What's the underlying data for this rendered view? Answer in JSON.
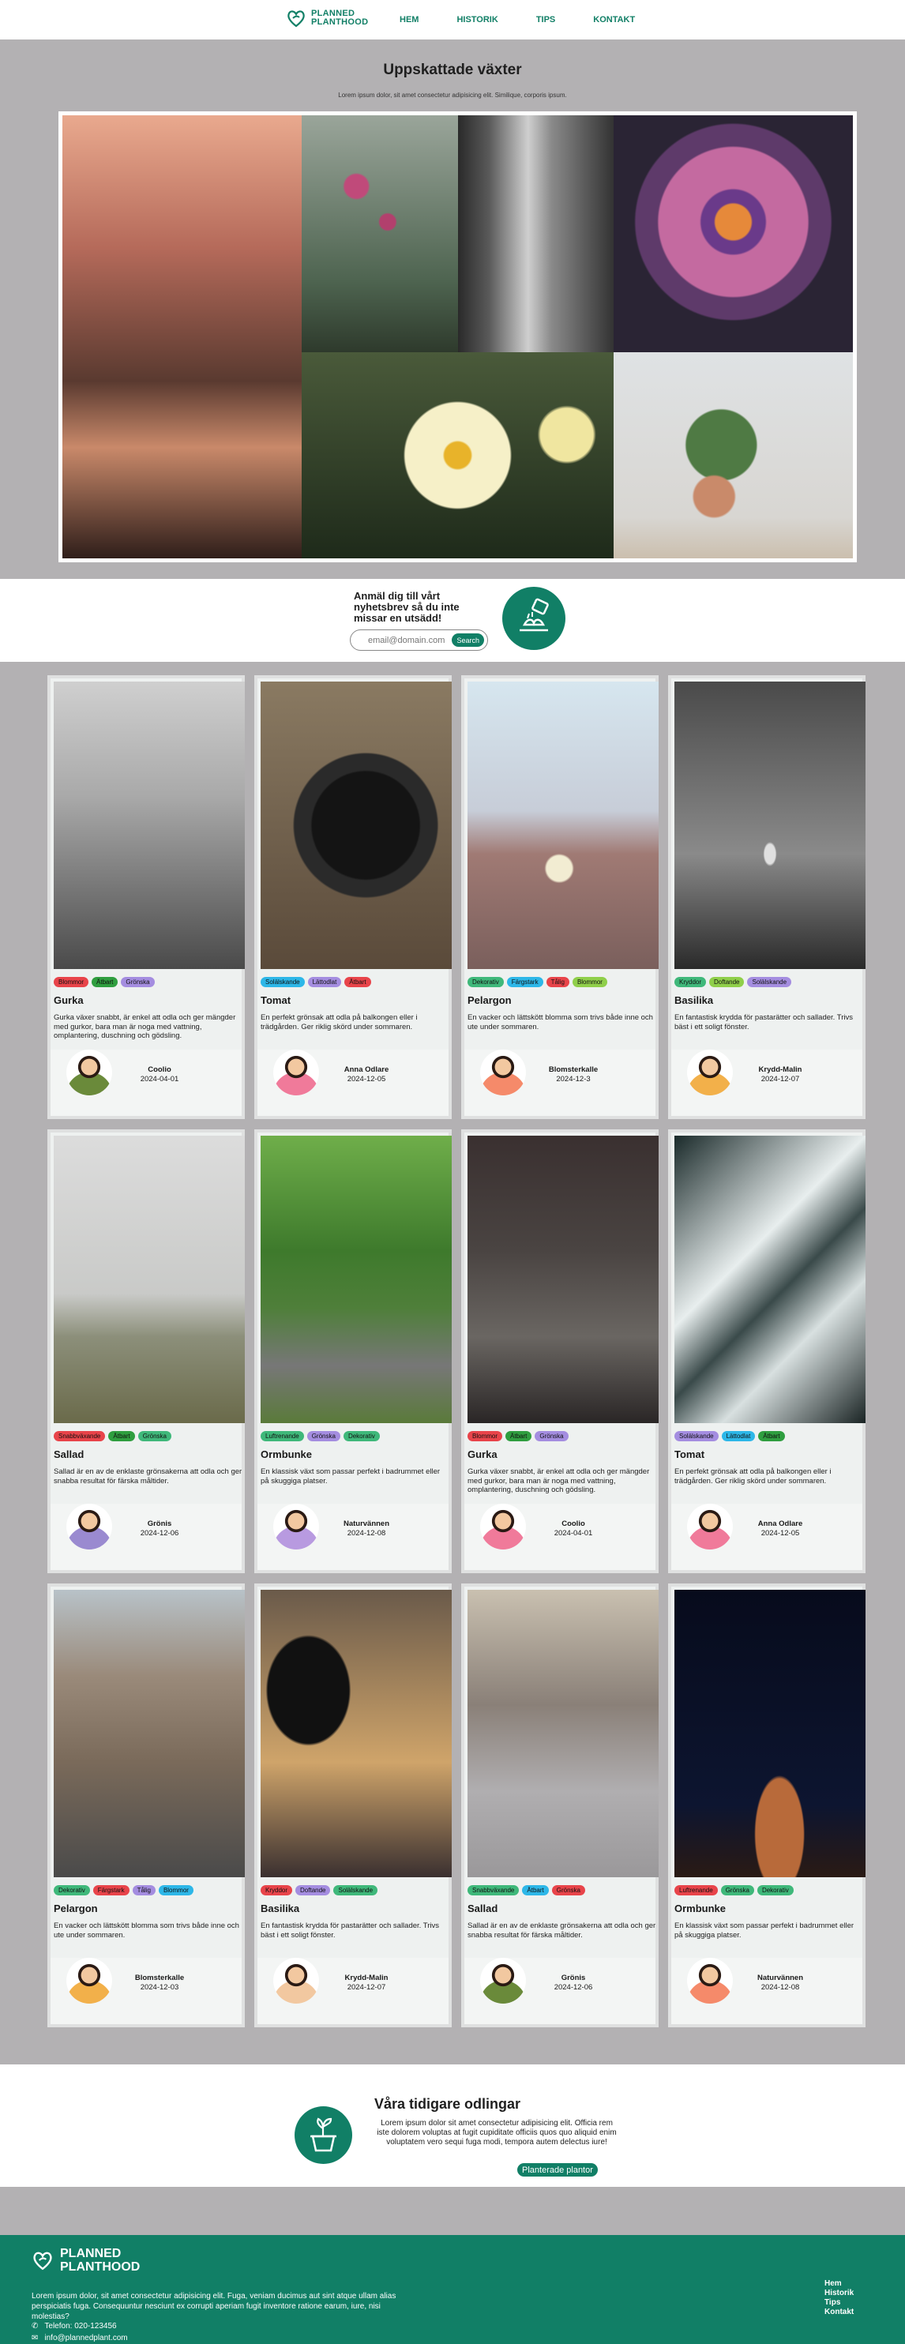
{
  "nav": {
    "logo_line1": "PLANNED",
    "logo_line2": "PLANTHOOD",
    "links": [
      "HEM",
      "HISTORIK",
      "TIPS",
      "KONTAKT"
    ]
  },
  "hero": {
    "title": "Uppskattade växter",
    "subtitle": "Lorem ipsum dolor, sit amet consectetur adipisicing elit. Similique, corporis ipsum."
  },
  "newsletter": {
    "text": "Anmäl dig till vårt nyhetsbrev så du inte missar en utsädd!",
    "placeholder": "email@domain.com",
    "button": "Search"
  },
  "cards": [
    {
      "title": "Gurka",
      "desc": "Gurka växer snabbt, är enkel att odla och ger mängder med gurkor, bara man är noga med vattning, omplantering, duschning och gödsling.",
      "author": "Coolio",
      "date": "2024-04-01",
      "tags": [
        {
          "label": "Blommor",
          "color": "#e8444a"
        },
        {
          "label": "Ätbart",
          "color": "#2f9e3f"
        },
        {
          "label": "Grönska",
          "color": "#a48de0"
        }
      ]
    },
    {
      "title": "Tomat",
      "desc": "En perfekt grönsak att odla på balkongen eller i trädgården. Ger riklig skörd under sommaren.",
      "author": "Anna Odlare",
      "date": "2024-12-05",
      "tags": [
        {
          "label": "Solälskande",
          "color": "#2db7e8"
        },
        {
          "label": "Lättodlat",
          "color": "#a48de0"
        },
        {
          "label": "Ätbart",
          "color": "#e8444a"
        }
      ]
    },
    {
      "title": "Pelargon",
      "desc": "En vacker och lättskött blomma som trivs både inne och ute under sommaren.",
      "author": "Blomsterkalle",
      "date": "2024-12-3",
      "tags": [
        {
          "label": "Dekorativ",
          "color": "#3fb87a"
        },
        {
          "label": "Färgstark",
          "color": "#2db7e8"
        },
        {
          "label": "Tålig",
          "color": "#e8444a"
        },
        {
          "label": "Blommor",
          "color": "#8fcf4a"
        }
      ]
    },
    {
      "title": "Basilika",
      "desc": "En fantastisk krydda för pastarätter och sallader. Trivs bäst i ett soligt fönster.",
      "author": "Krydd-Malin",
      "date": "2024-12-07",
      "tags": [
        {
          "label": "Kryddor",
          "color": "#3fb87a"
        },
        {
          "label": "Doftande",
          "color": "#8fcf4a"
        },
        {
          "label": "Solälskande",
          "color": "#a48de0"
        }
      ]
    },
    {
      "title": "Sallad",
      "desc": "Sallad är en av de enklaste grönsakerna att odla och ger snabba resultat för färska måltider.",
      "author": "Grönis",
      "date": "2024-12-06",
      "tags": [
        {
          "label": "Snabbväxande",
          "color": "#e8444a"
        },
        {
          "label": "Ätbart",
          "color": "#2f9e3f"
        },
        {
          "label": "Grönska",
          "color": "#3fb87a"
        }
      ]
    },
    {
      "title": "Ormbunke",
      "desc": "En klassisk växt som passar perfekt i badrummet eller på skuggiga platser.",
      "author": "Naturvännen",
      "date": "2024-12-08",
      "tags": [
        {
          "label": "Luftrenande",
          "color": "#3fb87a"
        },
        {
          "label": "Grönska",
          "color": "#a48de0"
        },
        {
          "label": "Dekorativ",
          "color": "#3fb87a"
        }
      ]
    },
    {
      "title": "Gurka",
      "desc": "Gurka växer snabbt, är enkel att odla och ger mängder med gurkor, bara man är noga med vattning, omplantering, duschning och gödsling.",
      "author": "Coolio",
      "date": "2024-04-01",
      "tags": [
        {
          "label": "Blommor",
          "color": "#e8444a"
        },
        {
          "label": "Ätbart",
          "color": "#2f9e3f"
        },
        {
          "label": "Grönska",
          "color": "#a48de0"
        }
      ]
    },
    {
      "title": "Tomat",
      "desc": "En perfekt grönsak att odla på balkongen eller i trädgården. Ger riklig skörd under sommaren.",
      "author": "Anna Odlare",
      "date": "2024-12-05",
      "tags": [
        {
          "label": "Solälskande",
          "color": "#a48de0"
        },
        {
          "label": "Lättodlat",
          "color": "#2db7e8"
        },
        {
          "label": "Ätbart",
          "color": "#2f9e3f"
        }
      ]
    },
    {
      "title": "Pelargon",
      "desc": "En vacker och lättskött blomma som trivs både inne och ute under sommaren.",
      "author": "Blomsterkalle",
      "date": "2024-12-03",
      "tags": [
        {
          "label": "Dekorativ",
          "color": "#3fb87a"
        },
        {
          "label": "Färgstark",
          "color": "#e8444a"
        },
        {
          "label": "Tålig",
          "color": "#a48de0"
        },
        {
          "label": "Blommor",
          "color": "#2db7e8"
        }
      ]
    },
    {
      "title": "Basilika",
      "desc": "En fantastisk krydda för pastarätter och sallader. Trivs bäst i ett soligt fönster.",
      "author": "Krydd-Malin",
      "date": "2024-12-07",
      "tags": [
        {
          "label": "Kryddor",
          "color": "#e8444a"
        },
        {
          "label": "Doftande",
          "color": "#a48de0"
        },
        {
          "label": "Solälskande",
          "color": "#3fb87a"
        }
      ]
    },
    {
      "title": "Sallad",
      "desc": "Sallad är en av de enklaste grönsakerna att odla och ger snabba resultat för färska måltider.",
      "author": "Grönis",
      "date": "2024-12-06",
      "tags": [
        {
          "label": "Snabbväxande",
          "color": "#3fb87a"
        },
        {
          "label": "Ätbart",
          "color": "#2db7e8"
        },
        {
          "label": "Grönska",
          "color": "#e8444a"
        }
      ]
    },
    {
      "title": "Ormbunke",
      "desc": "En klassisk växt som passar perfekt i badrummet eller på skuggiga platser.",
      "author": "Naturvännen",
      "date": "2024-12-08",
      "tags": [
        {
          "label": "Luftrenande",
          "color": "#e8444a"
        },
        {
          "label": "Grönska",
          "color": "#3fb87a"
        },
        {
          "label": "Dekorativ",
          "color": "#3fb87a"
        }
      ]
    }
  ],
  "previous": {
    "title": "Våra tidigare odlingar",
    "text": "Lorem ipsum dolor sit amet consectetur adipisicing elit. Officia rem iste dolorem voluptas at fugit cupiditate officiis quos quo aliquid enim voluptatem vero sequi fuga modi, tempora autem delectus iure!",
    "button": "Planterade plantor"
  },
  "footer": {
    "logo_line1": "PLANNED",
    "logo_line2": "PLANTHOOD",
    "desc": "Lorem ipsum dolor, sit amet consectetur adipisicing elit. Fuga, veniam ducimus aut sint atque ullam alias perspiciatis fuga. Consequuntur nesciunt ex corrupti aperiam fugit inventore ratione earum, iure, nisi molestias?",
    "phone": "Telefon: 020-123456",
    "email": "info@plannedplant.com",
    "links": [
      "Hem",
      "Historik",
      "Tips",
      "Kontakt"
    ]
  },
  "colors": {
    "brand": "#117f66",
    "page_bg": "#b3b1b3"
  }
}
